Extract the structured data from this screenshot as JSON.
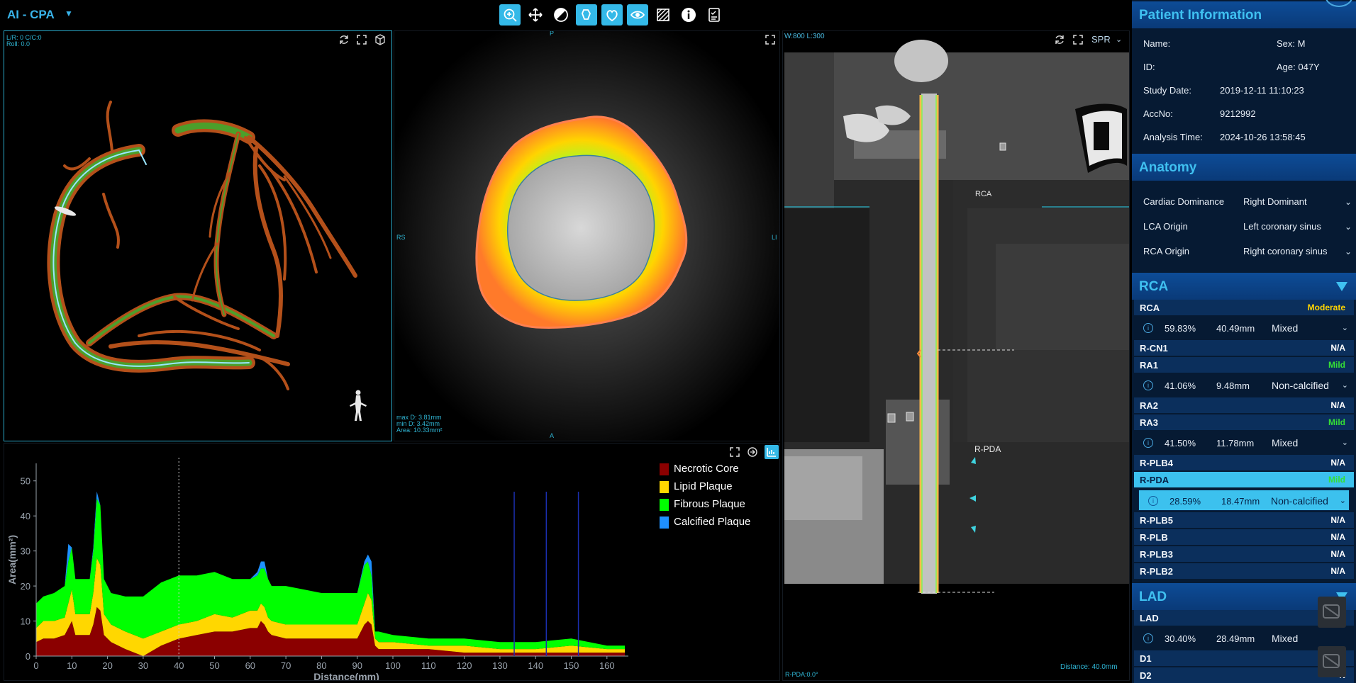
{
  "app": {
    "title": "AI - CPA"
  },
  "toolbar": {
    "tools": [
      {
        "name": "zoom-tool",
        "active": true
      },
      {
        "name": "pan-tool",
        "active": false
      },
      {
        "name": "window-level-tool",
        "active": false
      },
      {
        "name": "roi-tool",
        "active": true
      },
      {
        "name": "heart-tool",
        "active": true
      },
      {
        "name": "visibility-tool",
        "active": true
      },
      {
        "name": "hatch-tool",
        "active": false
      },
      {
        "name": "info-tool",
        "active": false
      },
      {
        "name": "report-tool",
        "active": false
      }
    ]
  },
  "viewer3d": {
    "info_line1": "L/R: 0   C/C:0",
    "info_line2": "Roll: 0.0"
  },
  "cross_section": {
    "orient_top": "P",
    "orient_bottom": "A",
    "orient_left": "RS",
    "orient_right": "LI",
    "stats": [
      "max D: 3.81mm",
      "min D: 3.42mm",
      "Area: 10.33mm²"
    ]
  },
  "cpr": {
    "window_level": "W:800  L:300",
    "mode": "SPR",
    "label_top": "RCA",
    "label_mid": "R-PDA",
    "footer_left": "R-PDA:0.0°",
    "footer_right": "Distance: 40.0mm"
  },
  "plaque_graph": {
    "legend": [
      {
        "label": "Necrotic Core",
        "color": "#8b0000"
      },
      {
        "label": "Lipid Plaque",
        "color": "#ffd700"
      },
      {
        "label": "Fibrous Plaque",
        "color": "#00ff00"
      },
      {
        "label": "Calcified Plaque",
        "color": "#1e90ff"
      }
    ]
  },
  "chart_data": {
    "type": "area",
    "xlabel": "Distance(mm)",
    "ylabel": "Area(mm²)",
    "xlim": [
      0,
      166
    ],
    "ylim": [
      0,
      55
    ],
    "x_ticks": [
      "0",
      "10",
      "20",
      "30",
      "40",
      "50",
      "60",
      "70",
      "80",
      "90",
      "100",
      "110",
      "120",
      "130",
      "140",
      "150",
      "160"
    ],
    "y_ticks": [
      "0",
      "10",
      "20",
      "30",
      "40",
      "50"
    ],
    "grid": false,
    "legend_position": "top-right",
    "cursor_x": 40,
    "markers_x": [
      134,
      143,
      152
    ],
    "x": [
      0,
      2,
      5,
      8,
      9,
      10,
      11,
      12,
      15,
      16,
      17,
      18,
      19,
      21,
      25,
      30,
      35,
      40,
      45,
      50,
      55,
      60,
      62,
      63,
      64,
      65,
      66,
      70,
      75,
      80,
      85,
      90,
      92,
      93,
      94,
      95,
      96,
      100,
      110,
      120,
      130,
      140,
      150,
      160,
      165
    ],
    "series": [
      {
        "name": "Necrotic Core",
        "values": [
          4,
          5,
          5,
          6,
          8,
          10,
          6,
          6,
          6,
          9,
          14,
          13,
          6,
          4,
          2,
          0,
          3,
          5,
          6,
          7,
          7,
          8,
          8,
          10,
          9,
          7,
          6,
          5,
          5,
          5,
          5,
          5,
          9,
          10,
          9,
          3,
          2,
          2,
          2,
          1,
          1,
          1,
          1,
          1,
          1
        ]
      },
      {
        "name": "Lipid Plaque",
        "values": [
          4,
          5,
          5,
          5,
          7,
          9,
          6,
          6,
          6,
          9,
          14,
          13,
          6,
          5,
          5,
          5,
          4,
          4,
          4,
          5,
          4,
          5,
          5,
          5,
          5,
          4,
          4,
          4,
          4,
          4,
          4,
          4,
          6,
          8,
          7,
          2,
          2,
          2,
          1,
          2,
          1,
          1,
          2,
          1,
          1
        ]
      },
      {
        "name": "Fibrous Plaque",
        "values": [
          7,
          7,
          8,
          9,
          12,
          12,
          10,
          10,
          10,
          12,
          17,
          17,
          10,
          9,
          10,
          12,
          14,
          14,
          13,
          12,
          11,
          9,
          10,
          10,
          11,
          11,
          10,
          11,
          10,
          9,
          9,
          9,
          11,
          9,
          7,
          2,
          3,
          2,
          2,
          2,
          2,
          2,
          2,
          1,
          1
        ]
      },
      {
        "name": "Calcified Plaque",
        "values": [
          0,
          0,
          0,
          0,
          5,
          0,
          0,
          0,
          0,
          1,
          2,
          0,
          0,
          0,
          0,
          0,
          0,
          0,
          0,
          0,
          0,
          0,
          1,
          2,
          2,
          0,
          0,
          0,
          0,
          0,
          0,
          0,
          1,
          2,
          4,
          0,
          0,
          0,
          0,
          0,
          0,
          0,
          0,
          0,
          0
        ]
      }
    ]
  },
  "patient": {
    "header": "Patient Information",
    "name_label": "Name:",
    "name_value": "",
    "sex": "Sex: M",
    "id_label": "ID:",
    "age": "Age: 047Y",
    "study_date_label": "Study Date:",
    "study_date": "2019-12-11 11:10:23",
    "accno_label": "AccNo:",
    "accno": "9212992",
    "analysis_time_label": "Analysis Time:",
    "analysis_time": "2024-10-26 13:58:45"
  },
  "anatomy": {
    "header": "Anatomy",
    "rows": [
      {
        "label": "Cardiac Dominance",
        "value": "Right Dominant"
      },
      {
        "label": "LCA Origin",
        "value": "Left coronary sinus"
      },
      {
        "label": "RCA Origin",
        "value": "Right coronary sinus"
      }
    ]
  },
  "rca": {
    "header": "RCA",
    "segments": [
      {
        "name": "RCA",
        "status": "Moderate",
        "status_color": "#ffd400",
        "detail": {
          "stenosis": "59.83%",
          "length": "40.49mm",
          "type": "Mixed"
        }
      },
      {
        "name": "R-CN1",
        "status": "N/A",
        "status_color": "#ffffff"
      },
      {
        "name": "RA1",
        "status": "Mild",
        "status_color": "#35e035",
        "detail": {
          "stenosis": "41.06%",
          "length": "9.48mm",
          "type": "Non-calcified"
        }
      },
      {
        "name": "RA2",
        "status": "N/A",
        "status_color": "#ffffff"
      },
      {
        "name": "RA3",
        "status": "Mild",
        "status_color": "#35e035",
        "detail": {
          "stenosis": "41.50%",
          "length": "11.78mm",
          "type": "Mixed"
        }
      },
      {
        "name": "R-PLB4",
        "status": "N/A",
        "status_color": "#ffffff"
      },
      {
        "name": "R-PDA",
        "status": "Mild",
        "status_color": "#35e035",
        "selected": true,
        "detail": {
          "stenosis": "28.59%",
          "length": "18.47mm",
          "type": "Non-calcified"
        }
      },
      {
        "name": "R-PLB5",
        "status": "N/A",
        "status_color": "#ffffff"
      },
      {
        "name": "R-PLB",
        "status": "N/A",
        "status_color": "#ffffff"
      },
      {
        "name": "R-PLB3",
        "status": "N/A",
        "status_color": "#ffffff"
      },
      {
        "name": "R-PLB2",
        "status": "N/A",
        "status_color": "#ffffff"
      }
    ]
  },
  "lad": {
    "header": "LAD",
    "segments": [
      {
        "name": "LAD",
        "status": "M",
        "status_color": "#35e035",
        "detail": {
          "stenosis": "30.40%",
          "length": "28.49mm",
          "type": "Mixed"
        }
      },
      {
        "name": "D1",
        "status": "N",
        "status_color": "#ffffff"
      },
      {
        "name": "D2",
        "status": "N",
        "status_color": "#ffffff"
      }
    ]
  }
}
